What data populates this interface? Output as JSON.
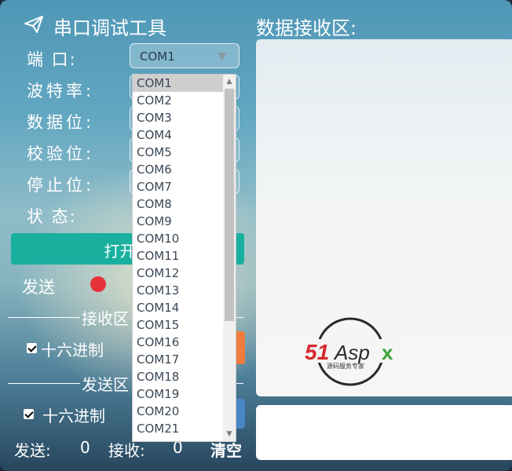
{
  "header": {
    "title": "串口调试工具",
    "icon": "paper-plane-icon"
  },
  "receive_panel": {
    "title": "数据接收区:"
  },
  "settings": {
    "port_label": "端   口:",
    "baud_label": "波特率:",
    "databits_label": "数据位:",
    "parity_label": "校验位:",
    "stopbits_label": "停止位:",
    "status_label": "状   态:",
    "port_value": "COM1"
  },
  "port_dropdown": {
    "options": [
      "COM1",
      "COM2",
      "COM3",
      "COM4",
      "COM5",
      "COM6",
      "COM7",
      "COM8",
      "COM9",
      "COM10",
      "COM11",
      "COM12",
      "COM13",
      "COM14",
      "COM15",
      "COM16",
      "COM17",
      "COM18",
      "COM19",
      "COM20",
      "COM21"
    ],
    "selected": "COM1"
  },
  "open_button": {
    "label": "打开串"
  },
  "send_status": {
    "label": "发送",
    "indicator_color": "#e8323a"
  },
  "receive_section": {
    "label": "接收区",
    "hex_label": "十六进制"
  },
  "send_section": {
    "label": "发送区",
    "hex_label": "十六进制"
  },
  "counters": {
    "send_label": "发送:",
    "send_count": "0",
    "recv_label": "接收:",
    "recv_count": "0",
    "clear_label": "清空"
  },
  "watermark": {
    "text": "51Aspx",
    "subtext": "源码服务专家"
  },
  "colors": {
    "accent": "#19b0a0",
    "orange": "#ef7c3c",
    "blue": "#4a86c5",
    "red": "#e8323a"
  }
}
